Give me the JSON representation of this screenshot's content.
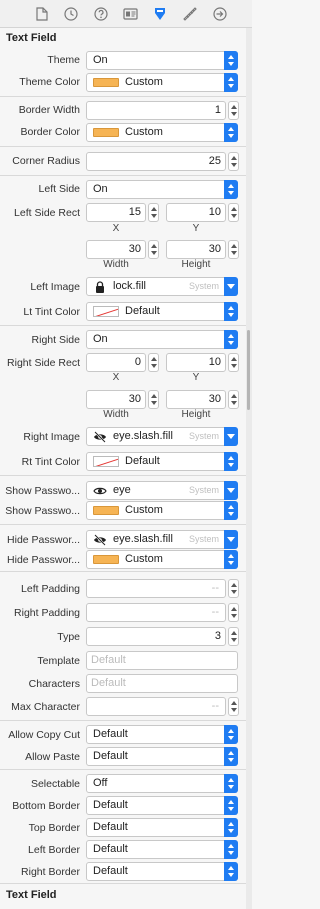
{
  "tabs": [
    {
      "name": "file-icon"
    },
    {
      "name": "history-icon"
    },
    {
      "name": "help-icon"
    },
    {
      "name": "identity-icon"
    },
    {
      "name": "attributes-icon",
      "active": true
    },
    {
      "name": "ruler-icon"
    },
    {
      "name": "connections-icon"
    }
  ],
  "accent_color": "#1f7cf2",
  "swatch_color": "#f6b454",
  "section": {
    "title": "Text Field",
    "footer_title": "Text Field"
  },
  "theme": {
    "label": "Theme",
    "value": "On"
  },
  "theme_color": {
    "label": "Theme Color",
    "value": "Custom"
  },
  "border_width": {
    "label": "Border Width",
    "value": "1"
  },
  "border_color": {
    "label": "Border Color",
    "value": "Custom"
  },
  "corner_radius": {
    "label": "Corner Radius",
    "value": "25"
  },
  "left_side": {
    "label": "Left Side",
    "value": "On"
  },
  "left_rect": {
    "label": "Left Side Rect",
    "x": "15",
    "y": "10",
    "width": "30",
    "height": "30",
    "x_label": "X",
    "y_label": "Y",
    "w_label": "Width",
    "h_label": "Height"
  },
  "left_image": {
    "label": "Left Image",
    "value": "lock.fill",
    "hint": "System"
  },
  "lt_tint": {
    "label": "Lt Tint Color",
    "value": "Default"
  },
  "right_side": {
    "label": "Right Side",
    "value": "On"
  },
  "right_rect": {
    "label": "Right Side Rect",
    "x": "0",
    "y": "10",
    "width": "30",
    "height": "30",
    "x_label": "X",
    "y_label": "Y",
    "w_label": "Width",
    "h_label": "Height"
  },
  "right_image": {
    "label": "Right Image",
    "value": "eye.slash.fill",
    "hint": "System"
  },
  "rt_tint": {
    "label": "Rt Tint Color",
    "value": "Default"
  },
  "show_pw_image": {
    "label": "Show Passwo...",
    "value": "eye",
    "hint": "System"
  },
  "show_pw_color": {
    "label": "Show Passwo...",
    "value": "Custom"
  },
  "hide_pw_image": {
    "label": "Hide Passwor...",
    "value": "eye.slash.fill",
    "hint": "System"
  },
  "hide_pw_color": {
    "label": "Hide Passwor...",
    "value": "Custom"
  },
  "left_padding": {
    "label": "Left Padding",
    "value": "--"
  },
  "right_padding": {
    "label": "Right Padding",
    "value": "--"
  },
  "type": {
    "label": "Type",
    "value": "3"
  },
  "template": {
    "label": "Template",
    "placeholder": "Default"
  },
  "characters": {
    "label": "Characters",
    "placeholder": "Default"
  },
  "max_character": {
    "label": "Max Character",
    "value": "--"
  },
  "allow_copy_cut": {
    "label": "Allow Copy Cut",
    "value": "Default"
  },
  "allow_paste": {
    "label": "Allow Paste",
    "value": "Default"
  },
  "selectable": {
    "label": "Selectable",
    "value": "Off"
  },
  "bottom_border": {
    "label": "Bottom Border",
    "value": "Default"
  },
  "top_border": {
    "label": "Top Border",
    "value": "Default"
  },
  "left_border": {
    "label": "Left Border",
    "value": "Default"
  },
  "right_border": {
    "label": "Right Border",
    "value": "Default"
  }
}
